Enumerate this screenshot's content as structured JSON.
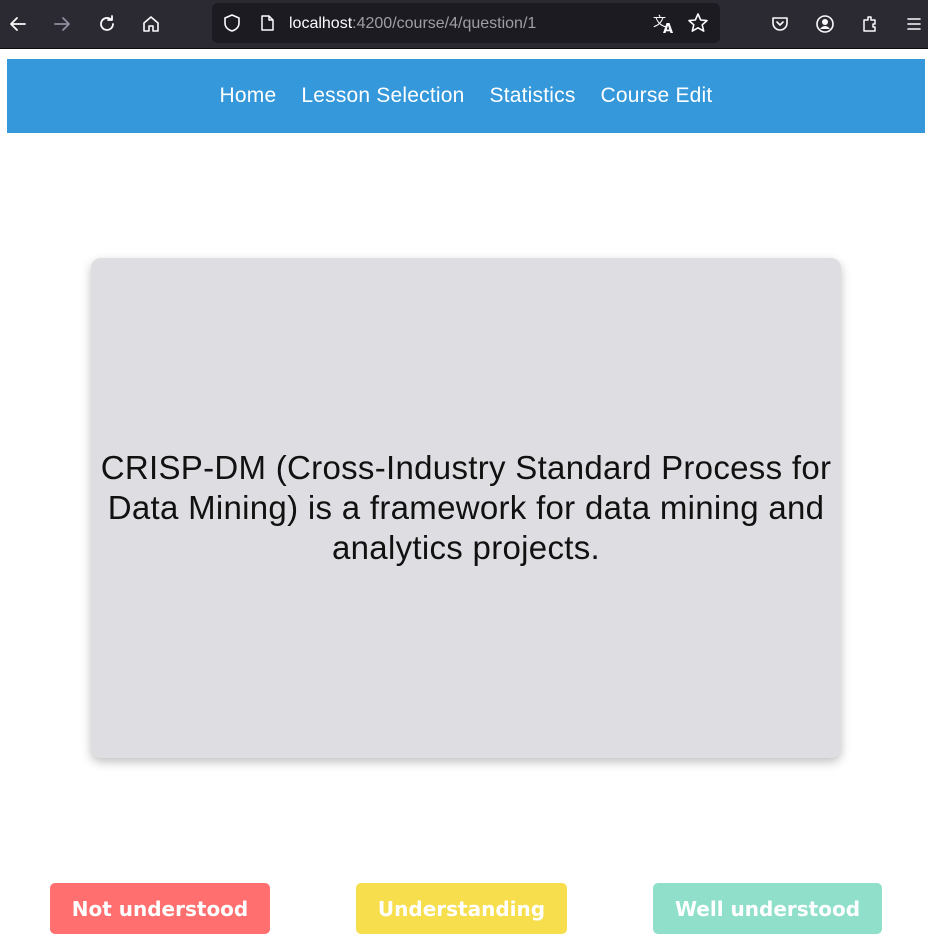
{
  "browser": {
    "url_host": "localhost",
    "url_path": ":4200/course/4/question/1",
    "icons": [
      "back-icon",
      "forward-icon",
      "reload-icon",
      "home-icon",
      "shield-icon",
      "page-icon",
      "translate-icon",
      "star-icon",
      "pocket-icon",
      "account-icon",
      "extensions-icon",
      "menu-icon"
    ]
  },
  "nav": {
    "items": [
      {
        "label": "Home"
      },
      {
        "label": "Lesson Selection"
      },
      {
        "label": "Statistics"
      },
      {
        "label": "Course Edit"
      }
    ],
    "background": "#3498db"
  },
  "card": {
    "text": "CRISP-DM (Cross-Industry Standard Process for Data Mining) is a framework for data mining and analytics projects.",
    "background": "#dedde2"
  },
  "ratings": {
    "not_understood": {
      "label": "Not understood",
      "color": "#ff6f6f"
    },
    "understanding": {
      "label": "Understanding",
      "color": "#f6de4c"
    },
    "well_understood": {
      "label": "Well understood",
      "color": "#8fdfcb"
    }
  }
}
